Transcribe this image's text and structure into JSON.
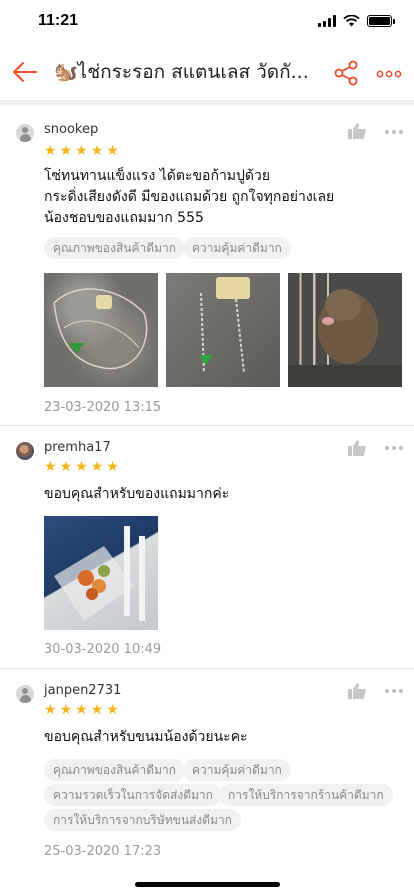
{
  "status": {
    "time": "11:21"
  },
  "header": {
    "title": "🐿️ไช่กระรอก สแตนเลส วัดกั..."
  },
  "colors": {
    "accent": "#ee4d2d",
    "star": "#f6b51e",
    "tag_bg": "#f1f1f1"
  },
  "icons": {
    "back": "arrow-left-icon",
    "share": "share-icon",
    "more": "more-icon",
    "like": "thumbs-up-icon",
    "avatar": "user-icon"
  },
  "reviews": [
    {
      "username": "snookep",
      "rating": 5,
      "comment_lines": [
        "โซ่ทนทานแข็งแรง ได้ตะขอก้ามปูด้วย",
        "กระดิ่งเสียงดังดี มีของแถมด้วย ถูกใจทุกอย่างเลย",
        "น้องชอบของแถมมาก 555"
      ],
      "tags": [
        "คุณภาพของสินค้าดีมาก",
        "ความคุ้มค่าดีมาก"
      ],
      "photo_count": 3,
      "timestamp": "23-03-2020 13:15"
    },
    {
      "username": "premha17",
      "rating": 5,
      "comment_lines": [
        "ขอบคุณสำหรับของแถมมากค่ะ"
      ],
      "tags": [],
      "photo_count": 1,
      "timestamp": "30-03-2020 10:49"
    },
    {
      "username": "janpen2731",
      "rating": 5,
      "comment_lines": [
        "ขอบคุณสำหรับขนมน้องด้วยนะคะ"
      ],
      "tags": [
        "คุณภาพของสินค้าดีมาก",
        "ความคุ้มค่าดีมาก",
        "ความรวดเร็วในการจัดส่งดีมาก",
        "การให้บริการจากร้านค้าดีมาก",
        "การให้บริการจากบริษัทขนส่งดีมาก"
      ],
      "photo_count": 0,
      "timestamp": "25-03-2020 17:23"
    }
  ]
}
